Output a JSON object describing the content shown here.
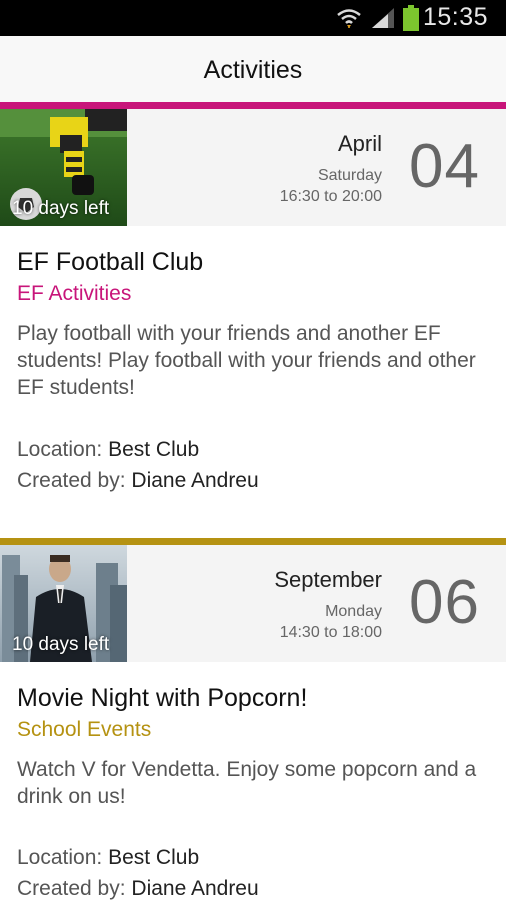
{
  "status_bar": {
    "time": "15:35"
  },
  "header": {
    "title": "Activities"
  },
  "events": [
    {
      "days_left": "10 days left",
      "month": "April",
      "weekday": "Saturday",
      "time_range": "16:30 to 20:00",
      "day": "04",
      "title": "EF Football Club",
      "category": "EF Activities",
      "accent_color": "#c8157a",
      "description": "Play football with your friends and another EF students! Play football with your friends and other EF students!",
      "location_label": "Location: ",
      "location": "Best Club",
      "created_by_label": "Created by: ",
      "created_by": "Diane Andreu"
    },
    {
      "days_left": "10 days left",
      "month": "September",
      "weekday": "Monday",
      "time_range": "14:30 to 18:00",
      "day": "06",
      "title": "Movie Night with Popcorn!",
      "category": "School Events",
      "accent_color": "#b59212",
      "description": "Watch V for Vendetta. Enjoy some popcorn and a drink on us!",
      "location_label": "Location: ",
      "location": "Best Club",
      "created_by_label": "Created by: ",
      "created_by": "Diane Andreu"
    }
  ],
  "icons": [
    "wifi-icon",
    "signal-icon",
    "battery-icon"
  ]
}
